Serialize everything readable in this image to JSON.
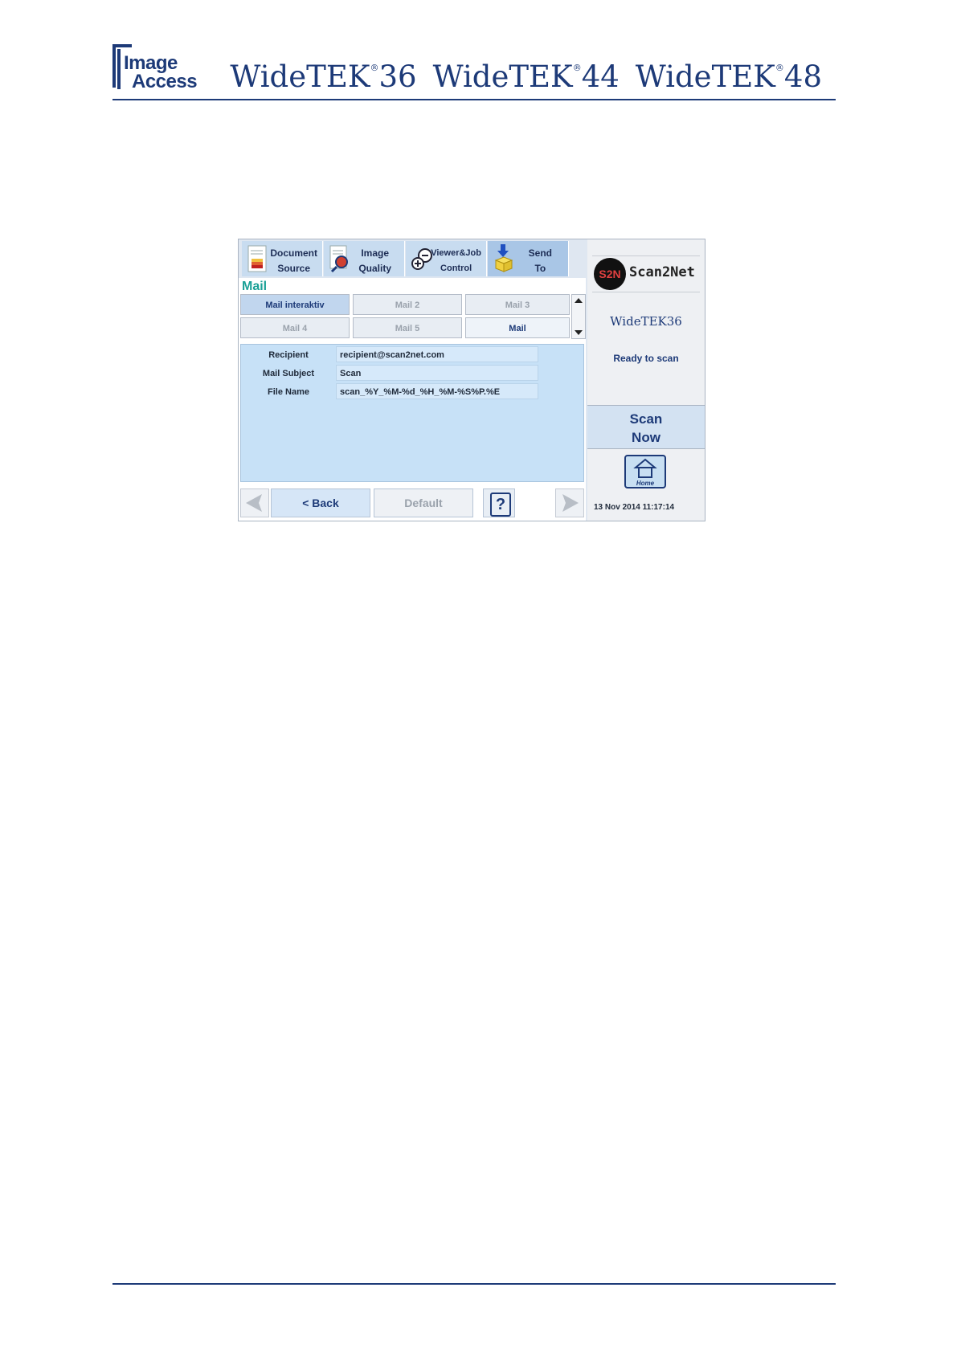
{
  "header": {
    "logo_line1": "Image",
    "logo_line2": "Access",
    "models": [
      {
        "name": "WideTEK",
        "reg": "®",
        "num": "36"
      },
      {
        "name": "WideTEK",
        "reg": "®",
        "num": "44"
      },
      {
        "name": "WideTEK",
        "reg": "®",
        "num": "48"
      }
    ]
  },
  "toolbar": {
    "items": [
      {
        "line1": "Document",
        "line2": "Source",
        "icon": "document-icon"
      },
      {
        "line1": "Image",
        "line2": "Quality",
        "icon": "magnifier-icon"
      },
      {
        "line1": "Viewer&Job",
        "line2": "Control",
        "icon": "zoom-control-icon"
      },
      {
        "line1": "Send",
        "line2": "To",
        "icon": "send-box-icon"
      }
    ]
  },
  "main": {
    "title": "Mail",
    "tabs": [
      {
        "label": "Mail interaktiv"
      },
      {
        "label": "Mail 2"
      },
      {
        "label": "Mail 3"
      },
      {
        "label": "Mail 4"
      },
      {
        "label": "Mail 5"
      },
      {
        "label": "Mail"
      }
    ],
    "fields": [
      {
        "label": "Recipient",
        "value": "recipient@scan2net.com"
      },
      {
        "label": "Mail Subject",
        "value": "Scan"
      },
      {
        "label": "File Name",
        "value": "scan_%Y_%M-%d_%H_%M-%S%P.%E"
      }
    ]
  },
  "bottom": {
    "back_label": "< Back",
    "default_label": "Default",
    "help_label": "?"
  },
  "side": {
    "brand_badge": "S2N",
    "brand": "Scan2Net",
    "model": "WideTEK36",
    "status": "Ready to scan",
    "scan_line1": "Scan",
    "scan_line2": "Now",
    "home_label": "Home",
    "datetime": "13 Nov 2014 11:17:14"
  },
  "colors": {
    "brand_blue": "#1d3a78",
    "title_teal": "#1aa096",
    "form_bg": "#c7e1f7"
  }
}
